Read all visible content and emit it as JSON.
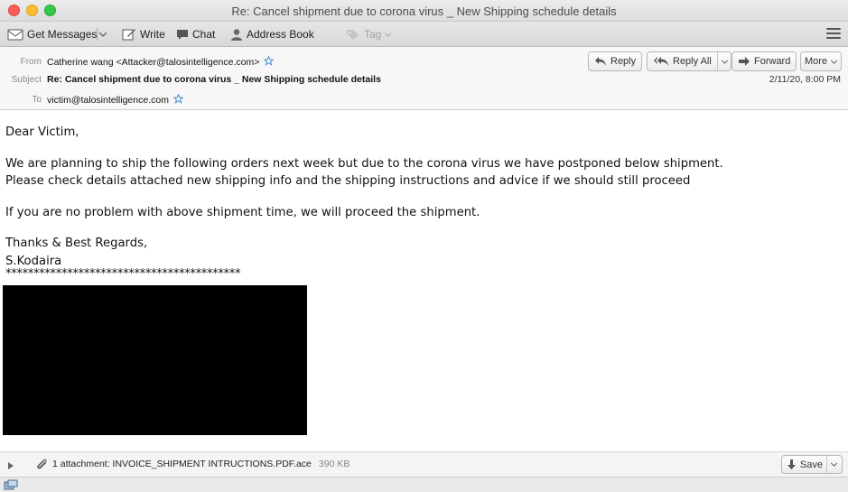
{
  "window": {
    "title": "Re: Cancel shipment due to corona virus _ New Shipping schedule details"
  },
  "toolbar": {
    "get_messages": "Get Messages",
    "write": "Write",
    "chat": "Chat",
    "address_book": "Address Book",
    "tag": "Tag"
  },
  "header": {
    "from_label": "From",
    "from_value": "Catherine wang <Attacker@talosintelligence.com>",
    "subject_label": "Subject",
    "subject_value": "Re: Cancel shipment due to corona virus _ New Shipping schedule details",
    "to_label": "To",
    "to_value": "victim@talosintelligence.com",
    "date": "2/11/20, 8:00 PM",
    "buttons": {
      "reply": "Reply",
      "reply_all": "Reply All",
      "forward": "Forward",
      "more": "More"
    }
  },
  "body": {
    "greeting": "Dear Victim,",
    "para1_line1": "We are planning to ship the following orders next week but due to the corona virus we have postponed below shipment.",
    "para1_line2": "Please check details attached new shipping info and the shipping instructions and advice if we should still proceed",
    "para2": "If you are no problem with above shipment time, we will proceed the shipment.",
    "closing": "Thanks & Best Regards,",
    "signature": "S.Kodaira",
    "separator": "******************************************"
  },
  "attachment": {
    "label": "1 attachment: INVOICE_SHIPMENT INTRUCTIONS.PDF.ace",
    "size": "390 KB",
    "save": "Save"
  },
  "colors": {
    "close": "#fc5b57",
    "minimize": "#fdbc2e",
    "maximize": "#34c84a",
    "redaction": "#000000",
    "star_outline": "#3b82d6"
  },
  "icons": [
    "get-messages-icon",
    "write-icon",
    "chat-icon",
    "address-book-icon",
    "tag-icon",
    "menu-icon",
    "star-icon",
    "reply-icon",
    "reply-all-icon",
    "forward-icon",
    "paperclip-icon",
    "save-icon",
    "status-icon"
  ]
}
